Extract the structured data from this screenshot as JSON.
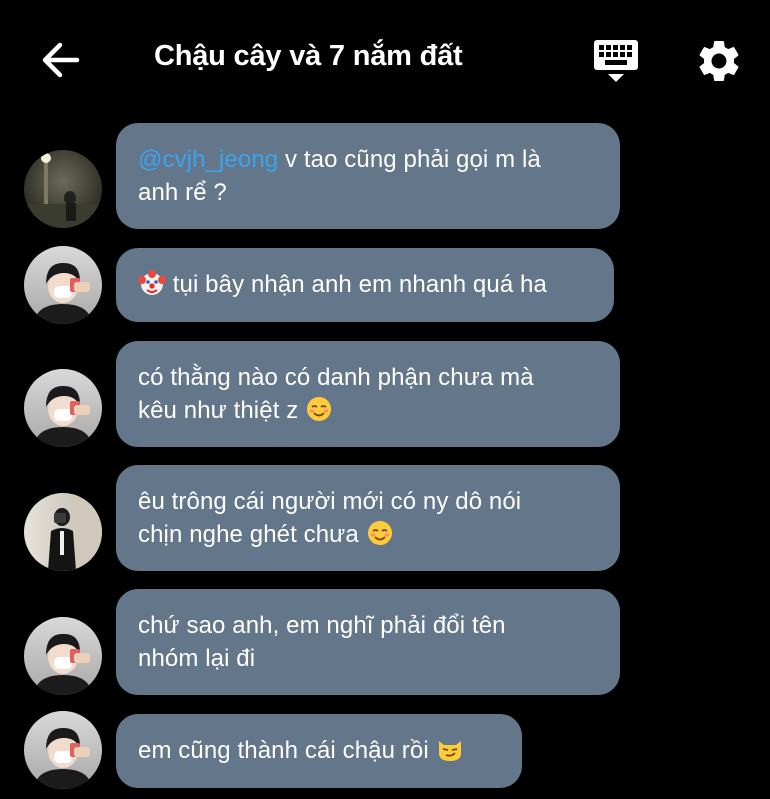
{
  "header": {
    "title": "Chậu cây và 7 nắm đất",
    "back_icon": "arrow-left-icon",
    "keyboard_icon": "keyboard-icon",
    "settings_icon": "gear-icon"
  },
  "colors": {
    "background": "#000000",
    "bubble": "#647689",
    "mention": "#3aa4ee",
    "text": "#ffffff"
  },
  "messages": [
    {
      "mention": "@cvjh_jeong",
      "text_line1": " v tao cũng phải gọi m là",
      "text_line2": "anh rể ?"
    },
    {
      "emoji": "clown-face-emoji",
      "text_line1": " tụi bây nhận anh em nhanh quá ha"
    },
    {
      "text_line1": "có thằng nào có danh phận chưa mà",
      "text_line2": "kêu như thiệt z ",
      "emoji": "smiling-face-emoji"
    },
    {
      "text_line1": "êu trông cái người mới có ny dô nói",
      "text_line2": "chịn nghe ghét chưa ",
      "emoji": "smiling-face-emoji"
    },
    {
      "text_line1": "chứ sao anh, em nghĩ phải đổi tên",
      "text_line2": "nhóm lại đi"
    },
    {
      "text_line1": "em cũng thành cái chậu rồi ",
      "emoji": "smirking-cat-emoji"
    }
  ]
}
